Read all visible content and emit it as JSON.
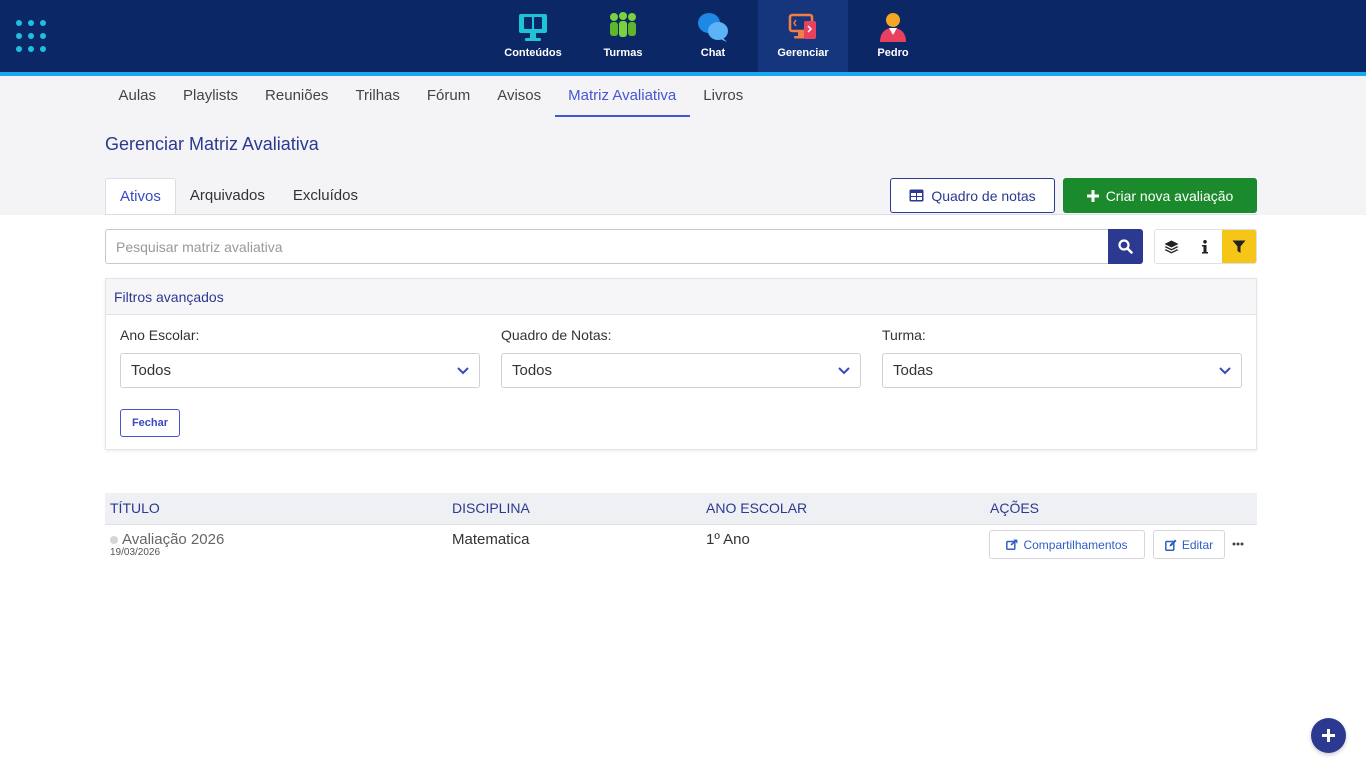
{
  "topnav": {
    "items": [
      {
        "label": "Conteúdos",
        "icon": "monitor-book-icon"
      },
      {
        "label": "Turmas",
        "icon": "people-group-icon"
      },
      {
        "label": "Chat",
        "icon": "chat-bubbles-icon"
      },
      {
        "label": "Gerenciar",
        "icon": "manage-devices-icon",
        "active": true
      },
      {
        "label": "Pedro",
        "icon": "user-avatar-icon"
      }
    ]
  },
  "subnav": {
    "items": [
      "Aulas",
      "Playlists",
      "Reuniões",
      "Trilhas",
      "Fórum",
      "Avisos",
      "Matriz Avaliativa",
      "Livros"
    ],
    "active": "Matriz Avaliativa"
  },
  "page": {
    "title": "Gerenciar Matriz Avaliativa"
  },
  "tabs": {
    "items": [
      "Ativos",
      "Arquivados",
      "Excluídos"
    ],
    "active": "Ativos"
  },
  "actions": {
    "grades_board": "Quadro de notas",
    "create_new": "Criar nova avaliação"
  },
  "search": {
    "placeholder": "Pesquisar matriz avaliativa",
    "value": ""
  },
  "filters": {
    "title": "Filtros avançados",
    "ano_escolar_label": "Ano Escolar:",
    "ano_escolar_value": "Todos",
    "quadro_label": "Quadro de Notas:",
    "quadro_value": "Todos",
    "turma_label": "Turma:",
    "turma_value": "Todas",
    "close": "Fechar"
  },
  "table": {
    "headers": [
      "TÍTULO",
      "DISCIPLINA",
      "ANO ESCOLAR",
      "AÇÕES"
    ],
    "rows": [
      {
        "title": "Avaliação 2026",
        "date": "19/03/2026",
        "discipline": "Matematica",
        "grade": "1º Ano",
        "share": "Compartilhamentos",
        "edit": "Editar"
      }
    ]
  },
  "colors": {
    "primary": "#2b3990",
    "topbar": "#0b2766",
    "accent_line": "#18a8f0",
    "success": "#1b8a2c",
    "filter_yellow": "#f5c518"
  }
}
